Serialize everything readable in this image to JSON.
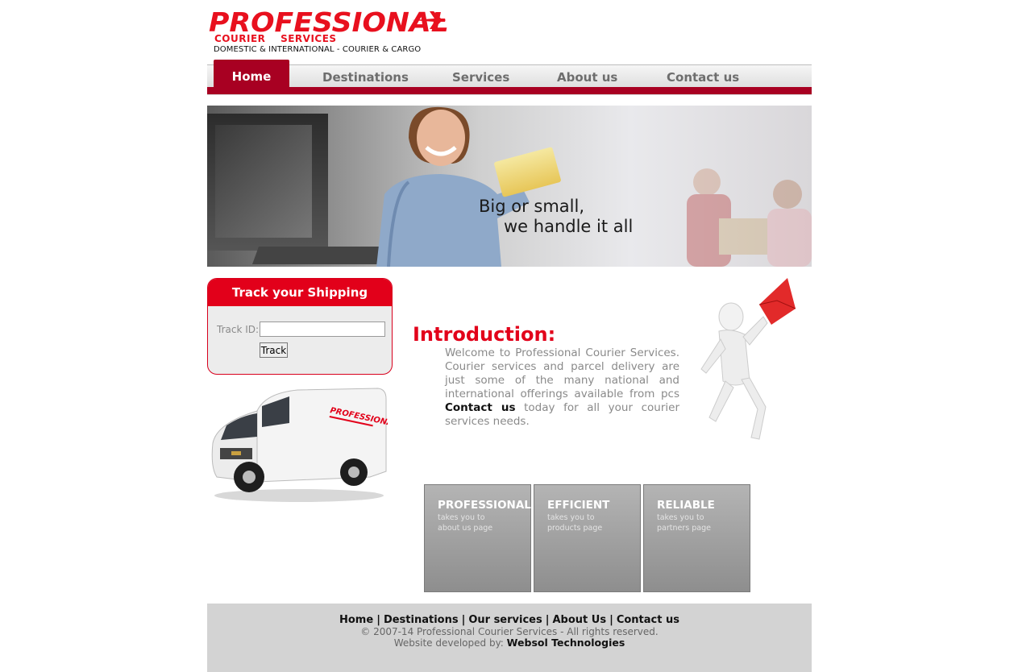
{
  "logo": {
    "brand": "PROFESSIONAL",
    "sub": "COURIER SERVICES",
    "tagline": "DOMESTIC & INTERNATIONAL - COURIER & CARGO"
  },
  "nav": {
    "items": [
      {
        "label": "Home",
        "active": true
      },
      {
        "label": "Destinations"
      },
      {
        "label": "Services"
      },
      {
        "label": "About us"
      },
      {
        "label": "Contact us"
      }
    ]
  },
  "banner": {
    "line1": "Big or small,",
    "line2": "we handle it all"
  },
  "track": {
    "title": "Track your Shipping",
    "label": "Track ID:",
    "input_value": "",
    "button": "Track"
  },
  "van": {
    "brand_text": "PROFESSIONAL"
  },
  "intro": {
    "title": "Introduction:",
    "text_before": "Welcome to Professional Courier Services. Courier services and parcel delivery are just some of the many national and international offerings available from pcs",
    "link": "Contact us",
    "text_after": "today for all your courier services needs."
  },
  "boxes": [
    {
      "title": "PROFESSIONAL",
      "line1": "takes you to",
      "line2": "about us page"
    },
    {
      "title": "EFFICIENT",
      "line1": "takes you to",
      "line2": "products page"
    },
    {
      "title": "RELIABLE",
      "line1": "takes you to",
      "line2": "partners page"
    }
  ],
  "footer": {
    "links": [
      "Home",
      "Destinations",
      "Our services",
      "About Us",
      "Contact us"
    ],
    "separator": "|",
    "copyright": "© 2007-14 Professional Courier Services - All rights reserved.",
    "dev_prefix": "Website developed by:",
    "dev_name": "Websol Technologies"
  },
  "colors": {
    "brand_red": "#e2001a",
    "nav_red": "#a80022",
    "footer_bg": "#d3d3d3"
  }
}
